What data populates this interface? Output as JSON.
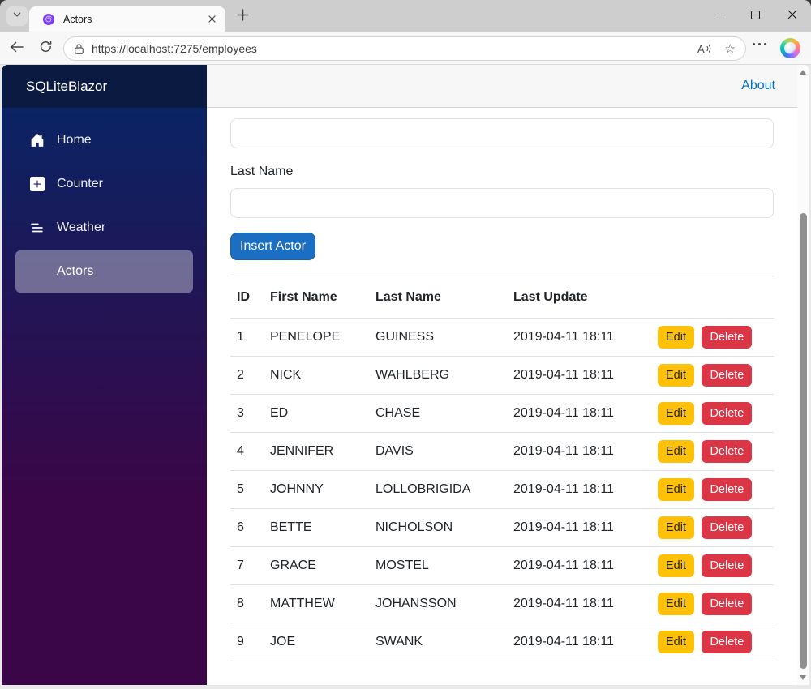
{
  "browser": {
    "tab_title": "Actors",
    "url": "https://localhost:7275/employees"
  },
  "icons": {
    "tab_dropdown": "chevron-down",
    "favicon": "blazor-purple-swirl",
    "tab_close": "x",
    "new_tab": "plus",
    "minimize": "thin-dash",
    "maximize": "outline-square",
    "close": "thin-x",
    "back": "left-arrow",
    "refresh": "circular-arrow",
    "lock": "padlock-outline",
    "read_aloud": "A-with-sound-waves",
    "favorite": "star-outline",
    "more": "three-dots",
    "copilot": "rainbow-orb",
    "home": "house-filled",
    "counter": "plus-square",
    "weather": "list-lines",
    "scroll_up": "triangle-up",
    "scroll_down": "triangle-down"
  },
  "sidebar": {
    "brand": "SQLiteBlazor",
    "items": [
      {
        "label": "Home",
        "active": false
      },
      {
        "label": "Counter",
        "active": false
      },
      {
        "label": "Weather",
        "active": false
      },
      {
        "label": "Actors",
        "active": true
      }
    ]
  },
  "topbar": {
    "about_label": "About"
  },
  "form": {
    "first_name_value": "",
    "last_name_label": "Last Name",
    "last_name_value": "",
    "insert_label": "Insert Actor"
  },
  "table": {
    "headers": [
      "ID",
      "First Name",
      "Last Name",
      "Last Update"
    ],
    "actions": {
      "edit": "Edit",
      "delete": "Delete"
    },
    "rows": [
      {
        "id": "1",
        "first": "PENELOPE",
        "last": "GUINESS",
        "updated": "2019-04-11 18:11"
      },
      {
        "id": "2",
        "first": "NICK",
        "last": "WAHLBERG",
        "updated": "2019-04-11 18:11"
      },
      {
        "id": "3",
        "first": "ED",
        "last": "CHASE",
        "updated": "2019-04-11 18:11"
      },
      {
        "id": "4",
        "first": "JENNIFER",
        "last": "DAVIS",
        "updated": "2019-04-11 18:11"
      },
      {
        "id": "5",
        "first": "JOHNNY",
        "last": "LOLLOBRIGIDA",
        "updated": "2019-04-11 18:11"
      },
      {
        "id": "6",
        "first": "BETTE",
        "last": "NICHOLSON",
        "updated": "2019-04-11 18:11"
      },
      {
        "id": "7",
        "first": "GRACE",
        "last": "MOSTEL",
        "updated": "2019-04-11 18:11"
      },
      {
        "id": "8",
        "first": "MATTHEW",
        "last": "JOHANSSON",
        "updated": "2019-04-11 18:11"
      },
      {
        "id": "9",
        "first": "JOE",
        "last": "SWANK",
        "updated": "2019-04-11 18:11"
      }
    ]
  },
  "colors": {
    "primary": "#1b6ec2",
    "warning": "#ffc107",
    "danger": "#dc3545",
    "link": "#0071c1",
    "sidebar_gradient_top": "#052767",
    "sidebar_gradient_bottom": "#3a0647",
    "brand_bar": "#0b1a41",
    "top_row_bg": "#f7f7f7"
  }
}
